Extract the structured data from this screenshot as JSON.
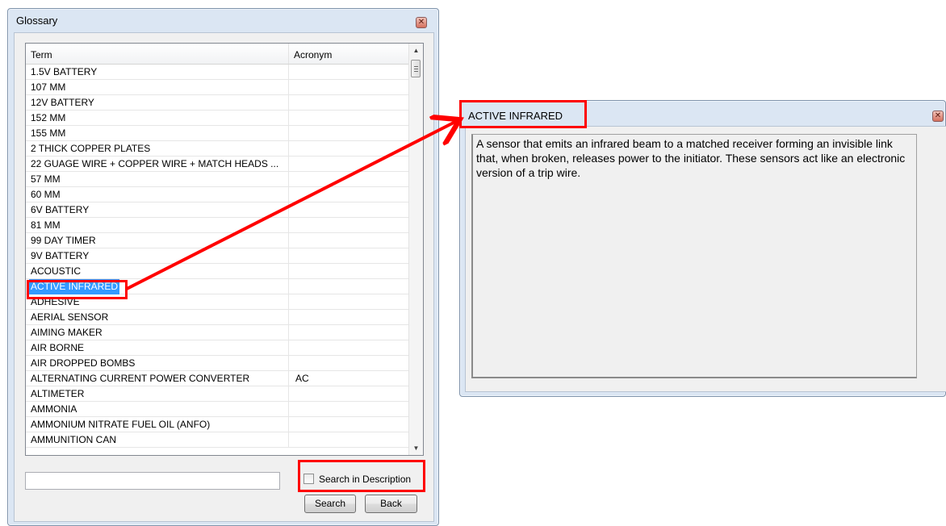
{
  "glossary": {
    "title": "Glossary",
    "columns": {
      "term": "Term",
      "acronym": "Acronym"
    },
    "rows": [
      {
        "term": "1.5V BATTERY",
        "acronym": ""
      },
      {
        "term": "107 MM",
        "acronym": ""
      },
      {
        "term": "12V BATTERY",
        "acronym": ""
      },
      {
        "term": "152 MM",
        "acronym": ""
      },
      {
        "term": "155 MM",
        "acronym": ""
      },
      {
        "term": "2 THICK COPPER PLATES",
        "acronym": ""
      },
      {
        "term": "22 GUAGE WIRE + COPPER WIRE + MATCH HEADS ...",
        "acronym": ""
      },
      {
        "term": "57 MM",
        "acronym": ""
      },
      {
        "term": "60 MM",
        "acronym": ""
      },
      {
        "term": "6V BATTERY",
        "acronym": ""
      },
      {
        "term": "81 MM",
        "acronym": ""
      },
      {
        "term": "99 DAY TIMER",
        "acronym": ""
      },
      {
        "term": "9V BATTERY",
        "acronym": ""
      },
      {
        "term": "ACOUSTIC",
        "acronym": ""
      },
      {
        "term": "ACTIVE INFRARED",
        "acronym": ""
      },
      {
        "term": "ADHESIVE",
        "acronym": ""
      },
      {
        "term": "AERIAL SENSOR",
        "acronym": ""
      },
      {
        "term": "AIMING MAKER",
        "acronym": ""
      },
      {
        "term": "AIR BORNE",
        "acronym": ""
      },
      {
        "term": "AIR DROPPED BOMBS",
        "acronym": ""
      },
      {
        "term": "ALTERNATING CURRENT POWER CONVERTER",
        "acronym": "AC"
      },
      {
        "term": "ALTIMETER",
        "acronym": ""
      },
      {
        "term": "AMMONIA",
        "acronym": ""
      },
      {
        "term": "AMMONIUM NITRATE FUEL OIL (ANFO)",
        "acronym": ""
      },
      {
        "term": "AMMUNITION CAN",
        "acronym": ""
      }
    ],
    "selected_term": "ACTIVE INFRARED",
    "search": {
      "value": "",
      "placeholder": ""
    },
    "search_in_description_label": "Search in Description",
    "search_in_description_checked": false,
    "search_button": "Search",
    "back_button": "Back"
  },
  "detail": {
    "title": "ACTIVE INFRARED",
    "description": "A sensor that emits an infrared beam to a matched receiver forming an invisible link that, when broken, releases power to the initiator. These sensors act like an electronic version of a trip wire."
  },
  "icons": {
    "close": "close-icon",
    "scroll_up": "arrow-up-icon",
    "scroll_down": "arrow-down-icon",
    "checkbox": "checkbox-icon"
  },
  "colors": {
    "highlight": "#ff0000",
    "selection": "#3399ff",
    "window_frame": "#dbe6f3"
  }
}
